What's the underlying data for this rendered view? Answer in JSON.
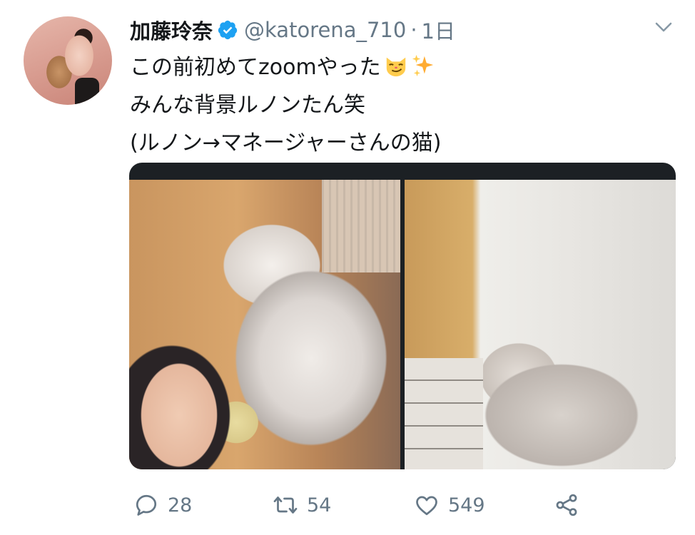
{
  "author": {
    "name": "加藤玲奈",
    "handle": "@katorena_710",
    "separator": "·",
    "time": "1日",
    "verified": true
  },
  "tweet": {
    "line1": "この前初めてzoomやった",
    "line1_emojis": [
      "smirking-cat-emoji",
      "sparkles-emoji"
    ],
    "line2": "みんな背景ルノンたん笑",
    "line3": "(ルノン→マネージャーさんの猫)"
  },
  "media": {
    "left_photo": "cat-and-person-photo",
    "right_photo": "cat-photo"
  },
  "actions": {
    "reply_count": "28",
    "retweet_count": "54",
    "like_count": "549"
  },
  "colors": {
    "verified_blue": "#1da1f2",
    "muted_gray": "#657786",
    "text_dark": "#14171a"
  }
}
